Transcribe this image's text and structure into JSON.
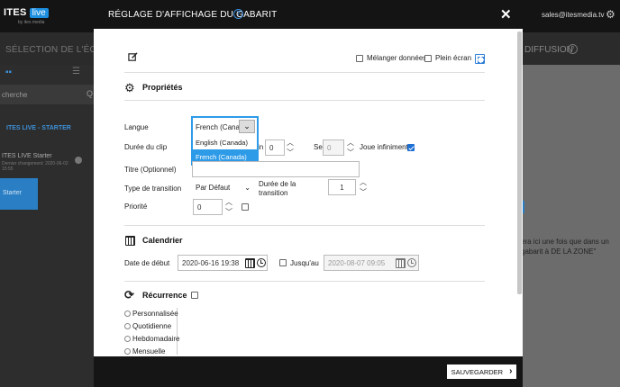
{
  "background": {
    "brand": "ITES",
    "brand_badge": "live",
    "brand_sub": "by ites media",
    "email": "sales@itesmedia.tv",
    "screen_selection": "SÉLECTION DE L'ÉCRAN",
    "diffusion": "DIFFUSION",
    "search_placeholder": "cherche",
    "starter_group": "ITES LIVE - STARTER",
    "item_title": "ITES LIVE Starter",
    "item_sub": "Dernier changement: 2020-06-02 15:55",
    "starter_button": "Starter",
    "side_text": "era ici une fois que dans un gabarit à DE LA ZONE\""
  },
  "modal": {
    "title": "RÉGLAGE D'AFFICHAGE DU GABARIT",
    "close": "✕",
    "mix_data_label": "Mélanger données",
    "fullscreen_label": "Plein écran",
    "properties_title": "Propriétés",
    "language_label": "Langue",
    "language_value": "French (Cana...",
    "language_options": [
      "English (Canada)",
      "French (Canada)"
    ],
    "clip_duration_label": "Durée du clip",
    "min_label": "in",
    "min_value": "0",
    "sec_label": "Sec",
    "sec_value": "0",
    "play_infinite_label": "Joue infiniment",
    "title_label": "Titre (Optionnel)",
    "transition_type_label": "Type de transition",
    "transition_type_value": "Par Défaut",
    "transition_duration_label": "Durée de la transition",
    "transition_duration_value": "1",
    "priority_label": "Priorité",
    "priority_value": "0",
    "calendar_title": "Calendrier",
    "start_date_label": "Date de début",
    "start_date_value": "2020-06-16 19:38",
    "until_label": "Jusqu'au",
    "end_date_value": "2020-08-07 09:05",
    "recurrence_title": "Récurrence",
    "recurrence_options": [
      "Personnalisée",
      "Quotidienne",
      "Hebdomadaire",
      "Mensuelle"
    ],
    "save_label": "SAUVEGARDER"
  },
  "colors": {
    "accent": "#2d9be8",
    "header": "#141414",
    "checkbox_on": "#1d6fd4"
  }
}
